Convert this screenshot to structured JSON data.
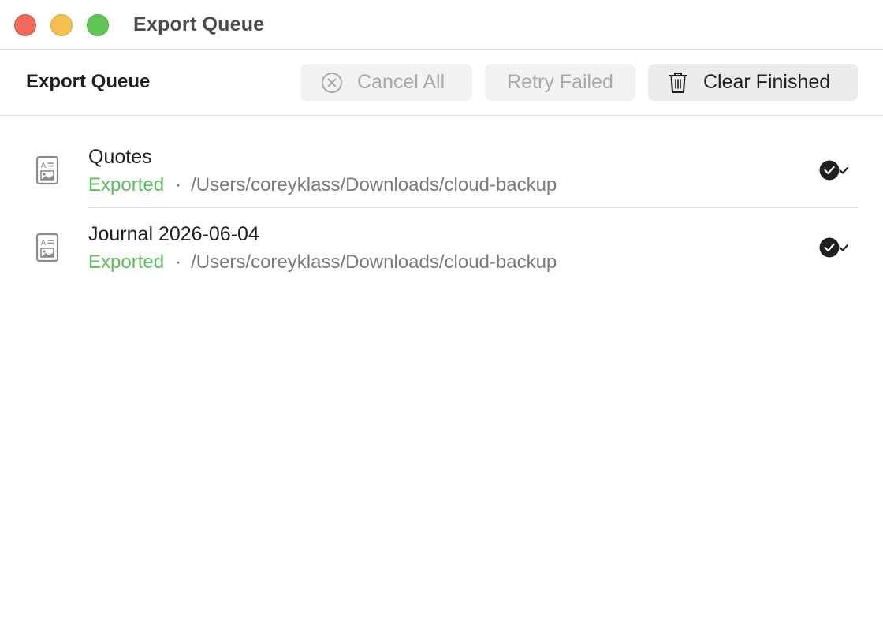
{
  "window": {
    "title": "Export Queue"
  },
  "toolbar": {
    "title": "Export Queue",
    "cancel_all": {
      "label": "Cancel All",
      "icon": "x-circle-icon",
      "enabled": false
    },
    "retry_failed": {
      "label": "Retry Failed",
      "enabled": false
    },
    "clear_finished": {
      "label": "Clear Finished",
      "icon": "trash-icon",
      "enabled": true
    }
  },
  "queue": {
    "items": [
      {
        "name": "Quotes",
        "status": "Exported",
        "separator": "·",
        "path": "/Users/coreyklass/Downloads/cloud-backup",
        "icon": "document-icon",
        "status_icon": "done-check-icon"
      },
      {
        "name": "Journal 2026-06-04",
        "status": "Exported",
        "separator": "·",
        "path": "/Users/coreyklass/Downloads/cloud-backup",
        "icon": "document-icon",
        "status_icon": "done-check-icon"
      }
    ]
  },
  "colors": {
    "status_exported": "#5bbf5b",
    "traffic_close": "#ec6a5e",
    "traffic_minimize": "#f4bf4f",
    "traffic_maximize": "#61c554"
  }
}
